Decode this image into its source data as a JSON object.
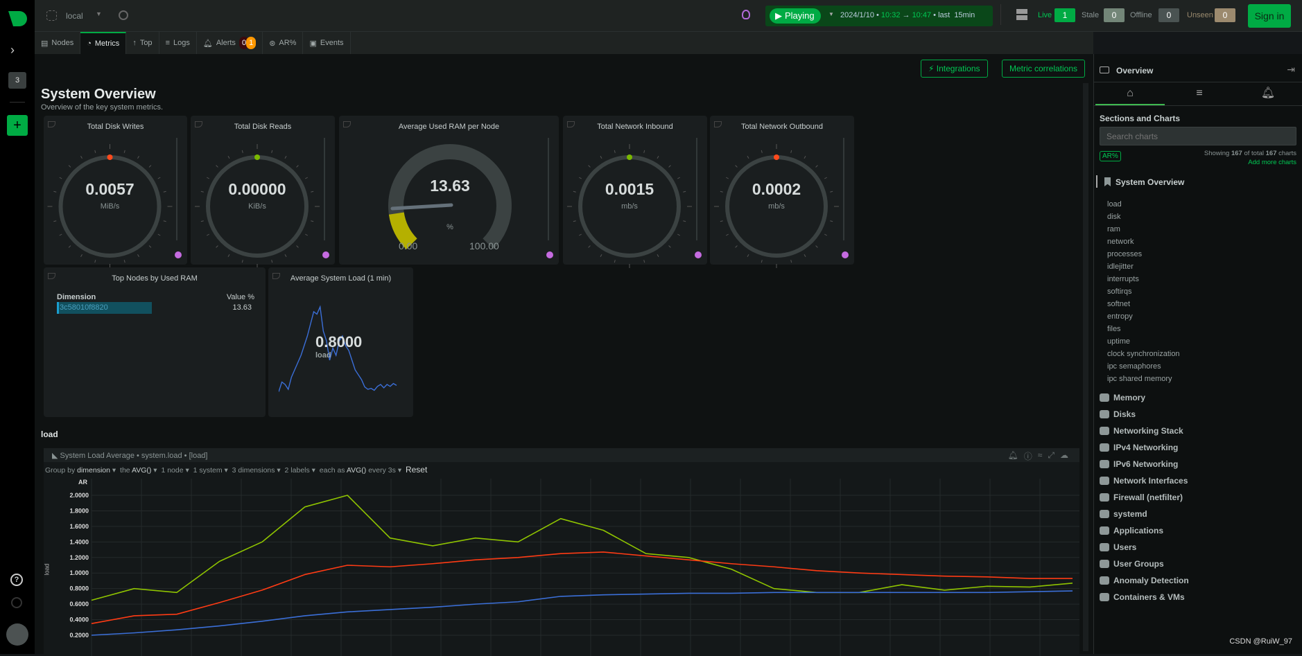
{
  "header": {
    "space": "local",
    "playing": "Playing",
    "date": "2024/1/10",
    "time_from": "10:32",
    "time_to": "10:47",
    "last": "last",
    "range": "15min",
    "live_label": "Live",
    "live": "1",
    "stale_label": "Stale",
    "stale": "0",
    "offline_label": "Offline",
    "offline": "0",
    "unseen_label": "Unseen",
    "unseen": "0",
    "signin": "Sign in"
  },
  "rail": {
    "badge": "3",
    "add": "+",
    "help": "?"
  },
  "tabs": [
    {
      "label": "Nodes"
    },
    {
      "label": "Metrics"
    },
    {
      "label": "Top"
    },
    {
      "label": "Logs"
    },
    {
      "label": "Alerts",
      "critical": "0",
      "warning": "1"
    },
    {
      "label": "AR%"
    },
    {
      "label": "Events"
    }
  ],
  "toolbar": {
    "integrations": "Integrations",
    "correlations": "Metric correlations"
  },
  "page": {
    "title": "System Overview",
    "subtitle": "Overview of the key system metrics.",
    "section": "load"
  },
  "gauges": [
    {
      "title": "Total Disk Writes",
      "value": "0.0057",
      "unit": "MiB/s",
      "dot": "#ff4a1c"
    },
    {
      "title": "Total Disk Reads",
      "value": "0.00000",
      "unit": "KiB/s",
      "dot": "#7ab800"
    },
    {
      "title": "Average Used RAM per Node",
      "value": "13.63",
      "unit": "%",
      "min": "0.00",
      "max": "100.00",
      "percent": 13.63,
      "color": "#b5b000"
    },
    {
      "title": "Total Network Inbound",
      "value": "0.0015",
      "unit": "mb/s",
      "dot": "#7ab800"
    },
    {
      "title": "Total Network Outbound",
      "value": "0.0002",
      "unit": "mb/s",
      "dot": "#ff4a1c"
    }
  ],
  "top_nodes": {
    "title": "Top Nodes by Used RAM",
    "col_dim": "Dimension",
    "col_val": "Value %",
    "rows": [
      {
        "dim": "3c58010f8820",
        "value": "13.63"
      }
    ]
  },
  "avg_load": {
    "title": "Average System Load (1 min)",
    "value": "0.8000",
    "unit": "load",
    "sparkline": [
      0.55,
      0.75,
      0.7,
      0.6,
      0.85,
      1.0,
      1.15,
      1.3,
      1.5,
      1.7,
      1.95,
      2.2,
      2.15,
      2.3,
      1.8,
      1.6,
      1.2,
      1.45,
      1.3,
      1.6,
      1.7,
      1.5,
      1.4,
      1.2,
      1.0,
      0.9,
      0.8,
      0.65,
      0.6,
      0.62,
      0.58,
      0.66,
      0.7,
      0.63,
      0.7,
      0.66,
      0.72,
      0.68
    ]
  },
  "chart_data": {
    "type": "line",
    "title": "System Load Average • system.load • [load]",
    "ylabel": "load",
    "units": "AR",
    "ylim": [
      0.2,
      2.0
    ],
    "yticks": [
      "2.0000",
      "1.8000",
      "1.6000",
      "1.4000",
      "1.2000",
      "1.0000",
      "0.8000",
      "0.6000",
      "0.4000",
      "0.2000"
    ],
    "grid": true,
    "series": [
      {
        "color": "#8fc400",
        "values": [
          0.65,
          0.8,
          0.75,
          1.15,
          1.4,
          1.85,
          2.0,
          1.45,
          1.35,
          1.45,
          1.4,
          1.7,
          1.55,
          1.25,
          1.2,
          1.05,
          0.8,
          0.75,
          0.75,
          0.85,
          0.78,
          0.83,
          0.82,
          0.87
        ]
      },
      {
        "color": "#ff3b14",
        "values": [
          0.35,
          0.45,
          0.47,
          0.62,
          0.78,
          0.98,
          1.1,
          1.08,
          1.12,
          1.17,
          1.2,
          1.25,
          1.27,
          1.22,
          1.17,
          1.12,
          1.08,
          1.03,
          1.0,
          0.98,
          0.96,
          0.95,
          0.93,
          0.93
        ]
      },
      {
        "color": "#3b6fd8",
        "values": [
          0.2,
          0.23,
          0.27,
          0.32,
          0.38,
          0.45,
          0.5,
          0.53,
          0.56,
          0.6,
          0.63,
          0.7,
          0.72,
          0.73,
          0.74,
          0.74,
          0.75,
          0.75,
          0.75,
          0.75,
          0.75,
          0.75,
          0.76,
          0.77
        ]
      }
    ]
  },
  "chart_controls": {
    "group_by": "Group by",
    "group_val": "dimension",
    "agg_pre": "the",
    "agg": "AVG()",
    "nodes": "1 node",
    "systems": "1 system",
    "dims": "3 dimensions",
    "labels": "2 labels",
    "each": "each as",
    "each_agg": "AVG()",
    "every": "every 3s",
    "reset": "Reset"
  },
  "sidebar": {
    "title": "Overview",
    "section_title": "Sections and Charts",
    "search_placeholder": "Search charts",
    "ar": "AR%",
    "showing": "Showing",
    "shown": "167",
    "of_total": "of total",
    "total": "167",
    "charts": "charts",
    "add_more": "Add more charts",
    "current": "System Overview",
    "subitems": [
      "load",
      "disk",
      "ram",
      "network",
      "processes",
      "idlejitter",
      "interrupts",
      "softirqs",
      "softnet",
      "entropy",
      "files",
      "uptime",
      "clock synchronization",
      "ipc semaphores",
      "ipc shared memory"
    ],
    "sections": [
      "Memory",
      "Disks",
      "Networking Stack",
      "IPv4 Networking",
      "IPv6 Networking",
      "Network Interfaces",
      "Firewall (netfilter)",
      "systemd",
      "Applications",
      "Users",
      "User Groups",
      "Anomaly Detection",
      "Containers & VMs"
    ]
  },
  "watermark": "CSDN @RuiW_97"
}
